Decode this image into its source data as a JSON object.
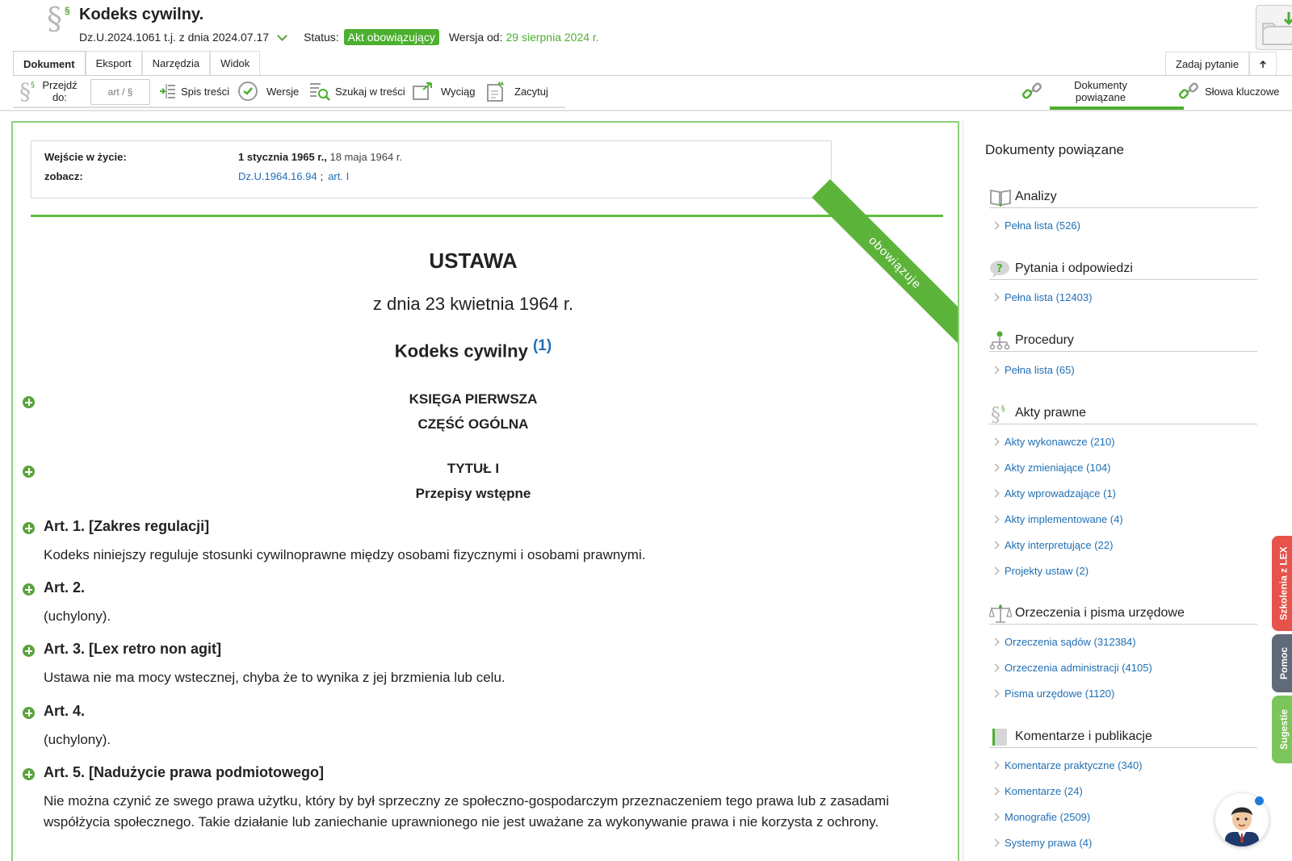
{
  "header": {
    "title": "Kodeks cywilny.",
    "journal_ref": "Dz.U.2024.1061 t.j. z dnia 2024.07.17",
    "status_label": "Status:",
    "status_value": "Akt obowiązujący",
    "version_label": "Wersja od:",
    "version_value": "29 sierpnia 2024 r."
  },
  "tabs": [
    "Dokument",
    "Eksport",
    "Narzędzia",
    "Widok"
  ],
  "tabs_right": {
    "ask": "Zadaj pytanie"
  },
  "toolbar": {
    "goto_label": "Przejdź do:",
    "goto_placeholder": "art / §",
    "toc": "Spis treści",
    "versions": "Wersje",
    "search": "Szukaj w treści",
    "extract": "Wyciąg",
    "quote": "Zacytuj",
    "related": "Dokumenty powiązane",
    "keywords": "Słowa kluczowe"
  },
  "meta": {
    "entry_label": "Wejście w życie:",
    "entry_bold": "1 stycznia 1965 r.,",
    "entry_rest": " 18 maja 1964 r.",
    "see_label": "zobacz:",
    "see_link1": "Dz.U.1964.16.94",
    "see_sep": ";",
    "see_link2": "art. I"
  },
  "ribbon": "obowiązuje",
  "document": {
    "heading": "USTAWA",
    "date": "z dnia 23 kwietnia 1964 r.",
    "name": "Kodeks cywilny",
    "footnote": "(1)",
    "book": "KSIĘGA  PIERWSZA",
    "part": "CZĘŚĆ OGÓLNA",
    "title_no": "TYTUŁ  I",
    "title_name": "Przepisy wstępne",
    "articles": [
      {
        "head": "Art.  1.   [Zakres regulacji]",
        "body": "Kodeks niniejszy reguluje stosunki cywilnoprawne między osobami fizycznymi i osobami prawnymi."
      },
      {
        "head": "Art.  2.",
        "body": "(uchylony)."
      },
      {
        "head": "Art.  3.   [Lex retro non agit]",
        "body": "Ustawa nie ma mocy wstecznej, chyba że to wynika z jej brzmienia lub celu."
      },
      {
        "head": "Art.  4.",
        "body": "(uchylony)."
      },
      {
        "head": "Art.  5.   [Nadużycie prawa podmiotowego]",
        "body": "Nie można czynić ze swego prawa użytku, który by był sprzeczny ze społeczno-gospodarczym przeznaczeniem tego prawa lub z zasadami współżycia społecznego. Takie działanie lub zaniechanie uprawnionego nie jest uważane za wykonywanie prawa i nie korzysta z ochrony."
      }
    ]
  },
  "side": {
    "title": "Dokumenty powiązane",
    "sections": [
      {
        "name": "Analizy",
        "links": [
          "Pełna lista (526)"
        ]
      },
      {
        "name": "Pytania i odpowiedzi",
        "links": [
          "Pełna lista (12403)"
        ]
      },
      {
        "name": "Procedury",
        "links": [
          "Pełna lista (65)"
        ]
      },
      {
        "name": "Akty prawne",
        "links": [
          "Akty wykonawcze (210)",
          "Akty zmieniające (104)",
          "Akty wprowadzające (1)",
          "Akty implementowane (4)",
          "Akty interpretujące (22)",
          "Projekty ustaw (2)"
        ]
      },
      {
        "name": "Orzeczenia i pisma urzędowe",
        "links": [
          "Orzeczenia sądów (312384)",
          "Orzeczenia administracji (4105)",
          "Pisma urzędowe (1120)"
        ]
      },
      {
        "name": "Komentarze i publikacje",
        "links": [
          "Komentarze praktyczne (340)",
          "Komentarze (24)",
          "Monografie (2509)",
          "Systemy prawa (4)"
        ]
      }
    ]
  },
  "vtabs": [
    "Szkolenia z LEX",
    "Pomoc",
    "Sugestie"
  ],
  "colors": {
    "brand_green": "#4caf2f",
    "link_blue": "#1f6fb5",
    "red_tab": "#e5534b",
    "gray_tab": "#5f6b78",
    "green_tab": "#7cc55b"
  }
}
